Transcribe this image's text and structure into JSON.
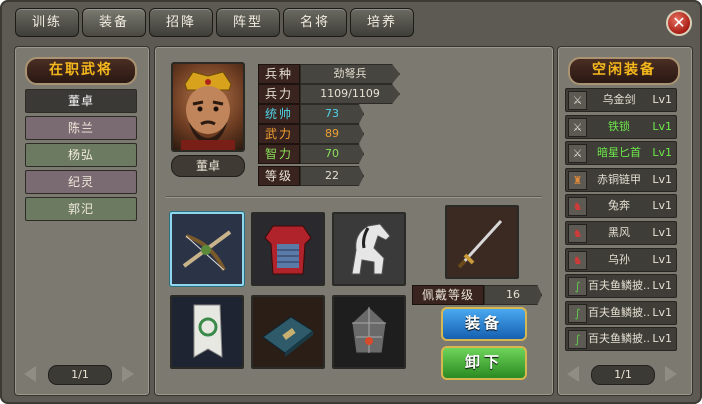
{
  "tabs": [
    {
      "label": "训练"
    },
    {
      "label": "装备"
    },
    {
      "label": "招降"
    },
    {
      "label": "阵型"
    },
    {
      "label": "名将"
    },
    {
      "label": "培养"
    }
  ],
  "active_tab": "装备",
  "left": {
    "title": "在职武将",
    "generals": [
      {
        "name": "董卓"
      },
      {
        "name": "陈兰"
      },
      {
        "name": "杨弘"
      },
      {
        "name": "纪灵"
      },
      {
        "name": "郭汜"
      }
    ],
    "pager": "1/1"
  },
  "hero": {
    "name": "董卓",
    "stats": [
      {
        "label": "兵种",
        "value": "劲弩兵",
        "color": "#e5e0d2"
      },
      {
        "label": "兵力",
        "value": "1109/1109",
        "color": "#e5e0d2"
      },
      {
        "label": "统帅",
        "value": "73",
        "color": "#4fd4e8"
      },
      {
        "label": "武力",
        "value": "89",
        "color": "#f0a030"
      },
      {
        "label": "智力",
        "value": "70",
        "color": "#8be05a"
      },
      {
        "label": "等级",
        "value": "22",
        "color": "#e5e0d2"
      }
    ],
    "wear_level_label": "佩戴等级",
    "wear_level_value": "16",
    "equip_btn": "装备",
    "unequip_btn": "卸下"
  },
  "right": {
    "title": "空闲装备",
    "items": [
      {
        "icon": "sword-icon",
        "glyph": "⚔",
        "name": "乌金剑",
        "lv": "Lv1",
        "color": "#e5e0d2"
      },
      {
        "icon": "sword-icon",
        "glyph": "⚔",
        "name": "铁锁",
        "lv": "Lv1",
        "color": "#6ee84a"
      },
      {
        "icon": "sword-icon",
        "glyph": "⚔",
        "name": "暗星匕首",
        "lv": "Lv1",
        "color": "#6ee84a"
      },
      {
        "icon": "armor-icon",
        "glyph": "♜",
        "name": "赤铜链甲",
        "lv": "Lv1",
        "color": "#e5e0d2"
      },
      {
        "icon": "horse-icon",
        "glyph": "♞",
        "name": "兔奔",
        "lv": "Lv1",
        "color": "#e5e0d2"
      },
      {
        "icon": "horse-icon",
        "glyph": "♞",
        "name": "黑风",
        "lv": "Lv1",
        "color": "#e5e0d2"
      },
      {
        "icon": "horse-icon",
        "glyph": "♞",
        "name": "乌孙",
        "lv": "Lv1",
        "color": "#e5e0d2"
      },
      {
        "icon": "scroll-icon",
        "glyph": "∫",
        "name": "百夫鱼鳞披...",
        "lv": "Lv1",
        "color": "#e5e0d2"
      },
      {
        "icon": "scroll-icon",
        "glyph": "∫",
        "name": "百夫鱼鳞披...",
        "lv": "Lv1",
        "color": "#e5e0d2"
      },
      {
        "icon": "scroll-icon",
        "glyph": "∫",
        "name": "百夫鱼鳞披...",
        "lv": "Lv1",
        "color": "#e5e0d2"
      }
    ],
    "pager": "1/1"
  },
  "colors": {
    "gold": "#f5b81c",
    "panel": "#7c7a70",
    "equip_btn": "#1f7fd6",
    "unequip_btn": "#3fa83a"
  }
}
